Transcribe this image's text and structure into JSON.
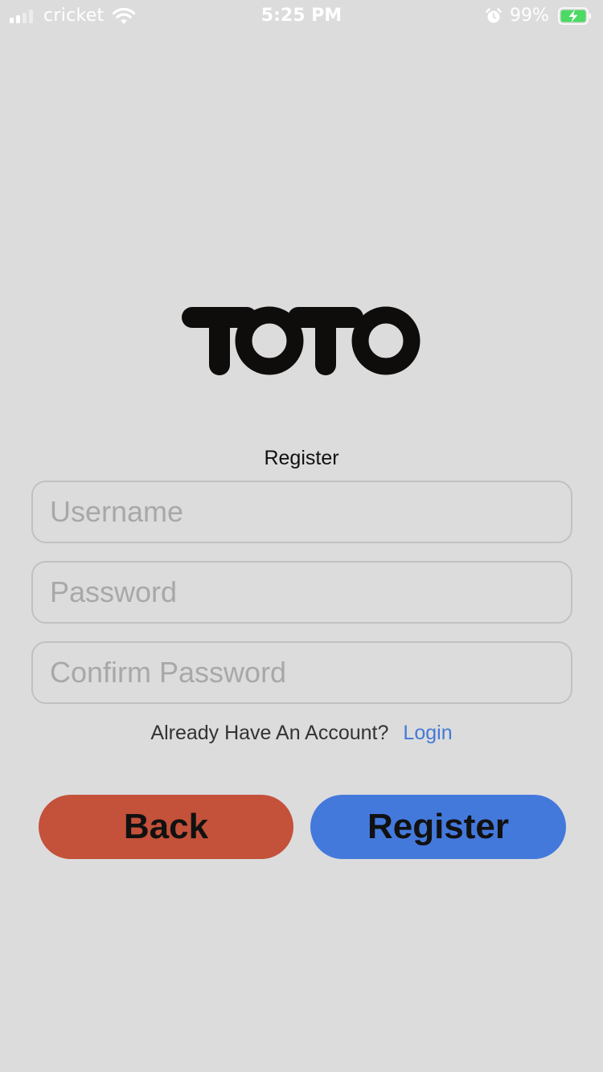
{
  "status_bar": {
    "carrier": "cricket",
    "time": "5:25 PM",
    "battery_percent": "99%",
    "signal_bars_active": 2,
    "signal_bars_total": 4,
    "icons": [
      "signal-icon",
      "wifi-icon",
      "alarm-icon",
      "battery-charging-icon"
    ]
  },
  "logo": {
    "text": "TOTO"
  },
  "form": {
    "title": "Register",
    "username": {
      "value": "",
      "placeholder": "Username"
    },
    "password": {
      "value": "",
      "placeholder": "Password"
    },
    "confirm_password": {
      "value": "",
      "placeholder": "Confirm Password"
    },
    "account_prompt": "Already Have An Account?",
    "login_link": "Login"
  },
  "buttons": {
    "back_label": "Back",
    "register_label": "Register"
  },
  "colors": {
    "background": "#dcdcdd",
    "back_button": "#c4513a",
    "register_button": "#4479dc",
    "link": "#4479d6",
    "battery_charge": "#4cd964"
  }
}
